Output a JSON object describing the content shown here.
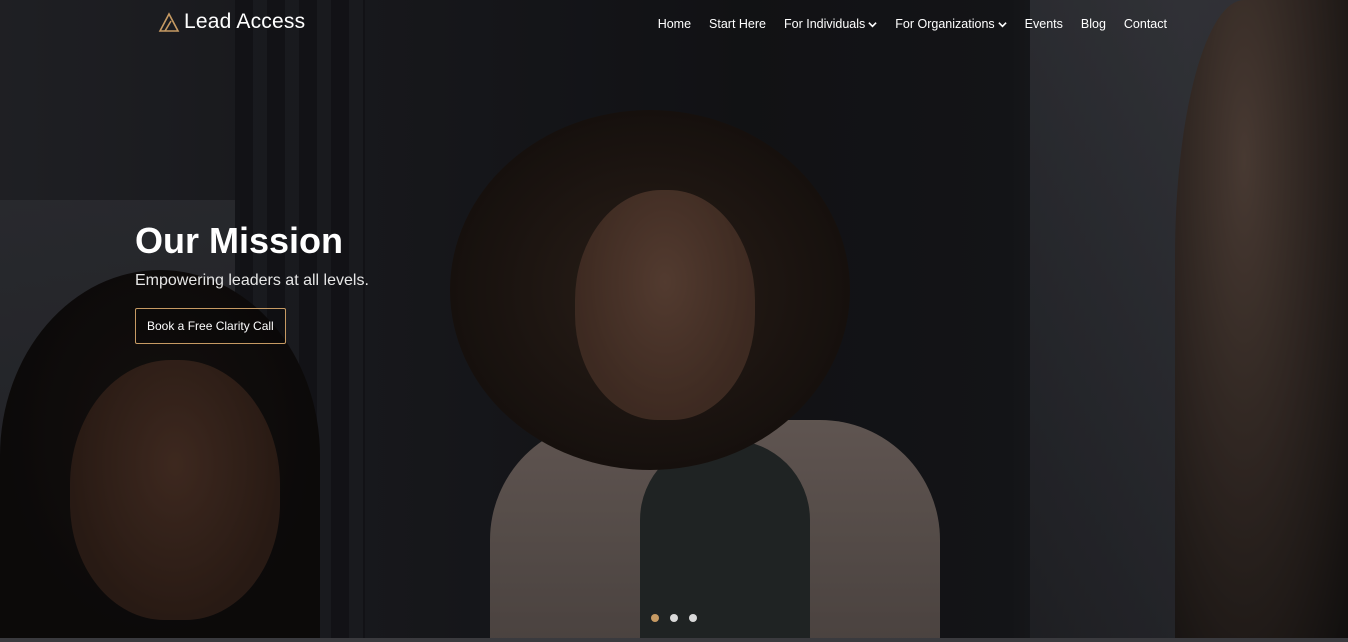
{
  "brand": {
    "name": "Lead Access",
    "accent": "#c69a63"
  },
  "nav": {
    "items": [
      {
        "label": "Home",
        "dropdown": false
      },
      {
        "label": "Start Here",
        "dropdown": false
      },
      {
        "label": "For Individuals",
        "dropdown": true
      },
      {
        "label": "For Organizations",
        "dropdown": true
      },
      {
        "label": "Events",
        "dropdown": false
      },
      {
        "label": "Blog",
        "dropdown": false
      },
      {
        "label": "Contact",
        "dropdown": false
      }
    ]
  },
  "hero": {
    "title": "Our Mission",
    "subtitle": "Empowering leaders at all levels.",
    "cta_label": "Book a Free Clarity Call"
  },
  "slider": {
    "slide_count": 3,
    "active_index": 0
  }
}
